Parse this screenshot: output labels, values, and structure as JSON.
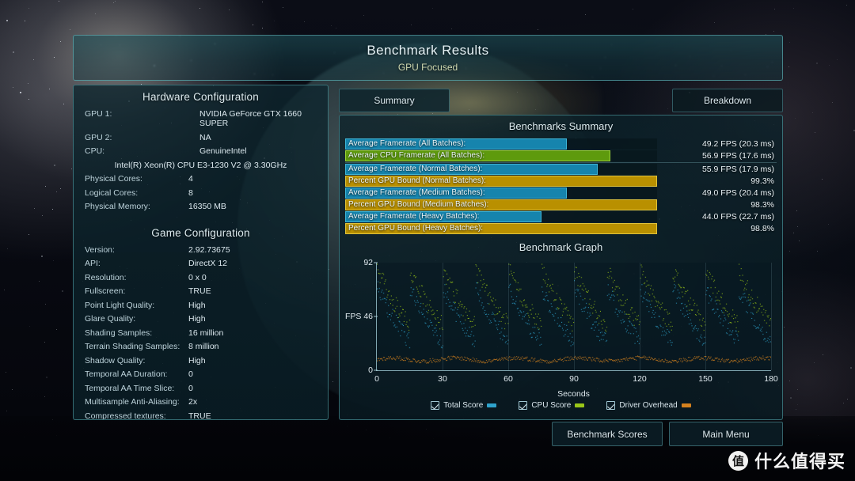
{
  "header": {
    "title": "Benchmark Results",
    "subtitle": "GPU Focused"
  },
  "tabs": {
    "summary": "Summary",
    "breakdown": "Breakdown"
  },
  "hardware": {
    "heading": "Hardware Configuration",
    "rows": [
      {
        "label": "GPU 1:",
        "value": "NVIDIA GeForce GTX 1660 SUPER"
      },
      {
        "label": "GPU 2:",
        "value": "NA"
      },
      {
        "label": "CPU:",
        "value": "GenuineIntel"
      }
    ],
    "cpu_full": "Intel(R) Xeon(R) CPU E3-1230 V2 @ 3.30GHz",
    "rows2": [
      {
        "label": "Physical Cores:",
        "value": "4"
      },
      {
        "label": "Logical Cores:",
        "value": "8"
      },
      {
        "label": "Physical Memory:",
        "value": "16350  MB"
      }
    ]
  },
  "game": {
    "heading": "Game Configuration",
    "rows": [
      {
        "label": "Version:",
        "value": "2.92.73675"
      },
      {
        "label": "API:",
        "value": "DirectX 12"
      },
      {
        "label": "Resolution:",
        "value": "0 x 0"
      },
      {
        "label": "Fullscreen:",
        "value": "TRUE"
      },
      {
        "label": "Point Light Quality:",
        "value": "High"
      },
      {
        "label": "Glare Quality:",
        "value": "High"
      },
      {
        "label": "Shading Samples:",
        "value": "16 million"
      },
      {
        "label": "Terrain Shading Samples:",
        "value": "8 million"
      },
      {
        "label": "Shadow Quality:",
        "value": "High"
      },
      {
        "label": "Temporal AA Duration:",
        "value": "0"
      },
      {
        "label": "Temporal AA Time Slice:",
        "value": "0"
      },
      {
        "label": "Multisample Anti-Aliasing:",
        "value": "2x"
      },
      {
        "label": "Compressed textures:",
        "value": "TRUE"
      }
    ]
  },
  "summary": {
    "heading": "Benchmarks Summary",
    "bars": [
      {
        "label": "Average Framerate (All Batches):",
        "value": "49.2 FPS (20.3 ms)",
        "pct": 71,
        "color": "blue"
      },
      {
        "label": "Average CPU Framerate (All Batches):",
        "value": "56.9 FPS (17.6 ms)",
        "pct": 85,
        "color": "green"
      },
      {
        "label": "Average Framerate (Normal Batches):",
        "value": "55.9 FPS (17.9 ms)",
        "pct": 81,
        "color": "blue"
      },
      {
        "label": "Percent GPU Bound (Normal Batches):",
        "value": "99.3%",
        "pct": 100,
        "color": "gold"
      },
      {
        "label": "Average Framerate (Medium Batches):",
        "value": "49.0 FPS (20.4 ms)",
        "pct": 71,
        "color": "blue"
      },
      {
        "label": "Percent GPU Bound (Medium Batches):",
        "value": "98.3%",
        "pct": 100,
        "color": "gold"
      },
      {
        "label": "Average Framerate (Heavy Batches):",
        "value": "44.0 FPS (22.7 ms)",
        "pct": 63,
        "color": "blue"
      },
      {
        "label": "Percent GPU Bound (Heavy Batches):",
        "value": "98.8%",
        "pct": 100,
        "color": "gold"
      }
    ]
  },
  "chart_data": {
    "type": "scatter",
    "title": "Benchmark Graph",
    "xlabel": "Seconds",
    "ylabel": "FPS",
    "xlim": [
      0,
      180
    ],
    "ylim": [
      0,
      92
    ],
    "xticks": [
      0,
      30,
      60,
      90,
      120,
      150,
      180
    ],
    "yticks": [
      0,
      46,
      92
    ],
    "grid": true,
    "legend_position": "bottom",
    "series": [
      {
        "name": "Total Score",
        "color": "#2fa3cc",
        "checked": true,
        "mean": 49.2,
        "min": 30,
        "max": 78
      },
      {
        "name": "CPU Score",
        "color": "#9ac618",
        "checked": true,
        "mean": 56.9,
        "min": 40,
        "max": 90
      },
      {
        "name": "Driver Overhead",
        "color": "#d4811e",
        "checked": true,
        "mean": 9.5,
        "min": 5,
        "max": 16
      }
    ]
  },
  "buttons": {
    "benchmark_scores": "Benchmark Scores",
    "main_menu": "Main Menu"
  },
  "watermark": {
    "badge": "值",
    "text": "什么值得买"
  }
}
